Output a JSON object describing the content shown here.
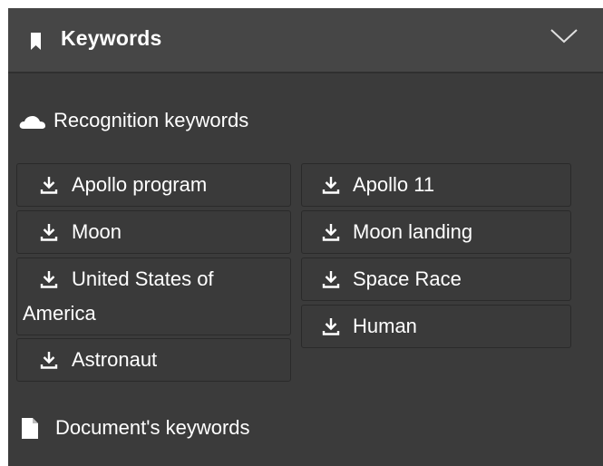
{
  "header": {
    "title": "Keywords",
    "icon": "bookmark-icon",
    "toggle_icon": "chevron-down-icon"
  },
  "recognition": {
    "label": "Recognition keywords",
    "icon": "cloud-icon",
    "chip_icon": "download-icon",
    "keywords": [
      "Apollo program",
      "Apollo 11",
      "Moon",
      "Moon landing",
      "United States of",
      "America",
      "Space Race",
      "Human",
      "Astronaut"
    ]
  },
  "document": {
    "label": "Document's keywords",
    "icon": "document-icon"
  }
}
